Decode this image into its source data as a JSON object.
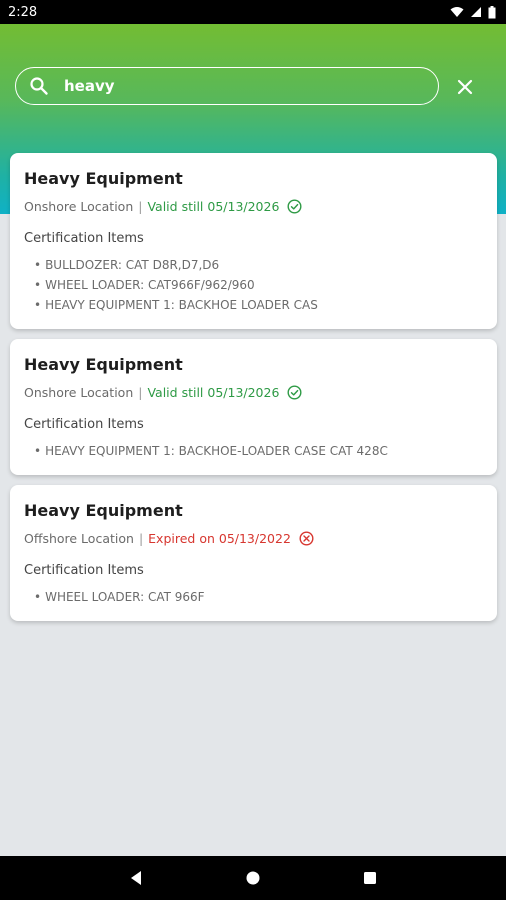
{
  "status_bar": {
    "time": "2:28"
  },
  "search": {
    "query": "heavy"
  },
  "colors": {
    "valid": "#2e9a45",
    "expired": "#d7362f",
    "header_top": "#73bd33",
    "header_bottom": "#0fb1c6"
  },
  "cards": [
    {
      "title": "Heavy Equipment",
      "location": "Onshore Location",
      "separator": "|",
      "status_text": "Valid still 05/13/2026",
      "status_type": "valid",
      "cert_heading": "Certification Items",
      "items": [
        "BULLDOZER: CAT D8R,D7,D6",
        "WHEEL LOADER: CAT966F/962/960",
        "HEAVY EQUIPMENT 1: BACKHOE LOADER CAS"
      ]
    },
    {
      "title": "Heavy Equipment",
      "location": "Onshore Location",
      "separator": "|",
      "status_text": "Valid still 05/13/2026",
      "status_type": "valid",
      "cert_heading": "Certification Items",
      "items": [
        "HEAVY EQUIPMENT 1: BACKHOE-LOADER CASE CAT 428C"
      ]
    },
    {
      "title": "Heavy Equipment",
      "location": "Offshore Location",
      "separator": "|",
      "status_text": "Expired on 05/13/2022",
      "status_type": "expired",
      "cert_heading": "Certification Items",
      "items": [
        "WHEEL LOADER: CAT 966F"
      ]
    }
  ]
}
